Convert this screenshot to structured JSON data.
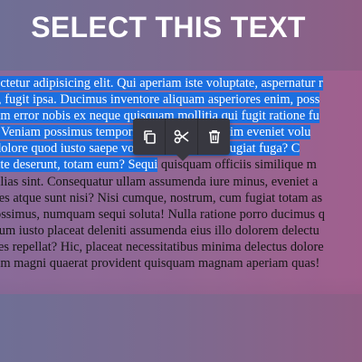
{
  "page": {
    "title": "SELECT THIS TEXT"
  },
  "paragraph": {
    "lines": [
      {
        "selected": "ectetur adipisicing elit. Qui aperiam iste voluptate, aspernatur r",
        "rest": ""
      },
      {
        "selected": "i, fugit ipsa. Ducimus inventore aliquam asperiores enim, poss",
        "rest": ""
      },
      {
        "selected": "am error nobis ex neque quisquam mollitia qui fugit ratione fu",
        "rest": ""
      },
      {
        "selected": ". Veniam possimus temporibus ullam nihil enim eveniet volu",
        "rest": ""
      },
      {
        "selected": "dolore quod iusto saepe voluptatibus beatae fugiat fuga? C",
        "rest": ""
      },
      {
        "selected": "ate deserunt, totam eum? Sequi",
        "rest": " quisquam officiis similique m"
      },
      {
        "selected": "",
        "rest": "alias sint. Consequatur ullam assumenda iure minus, eveniet a"
      },
      {
        "selected": "",
        "rest": "res atque sunt nisi? Nisi cumque, nostrum, cum fugiat totam as"
      },
      {
        "selected": "",
        "rest": "ossimus, numquam sequi soluta! Nulla ratione porro ducimus q"
      },
      {
        "selected": "",
        "rest": "rum iusto placeat deleniti assumenda eius illo dolorem delectu"
      },
      {
        "selected": "",
        "rest": "tes repellat? Hic, placeat necessitatibus minima delectus dolore"
      },
      {
        "selected": "",
        "rest": "am magni quaerat provident quisquam magnam aperiam quas!"
      }
    ]
  },
  "toolbar": {
    "actions": [
      {
        "name": "copy",
        "icon": "copy-icon"
      },
      {
        "name": "cut",
        "icon": "scissors-icon"
      },
      {
        "name": "delete",
        "icon": "trash-icon"
      }
    ]
  },
  "colors": {
    "selection": "#1b6fe0",
    "toolbar": "#383840",
    "title": "#ffffff"
  }
}
